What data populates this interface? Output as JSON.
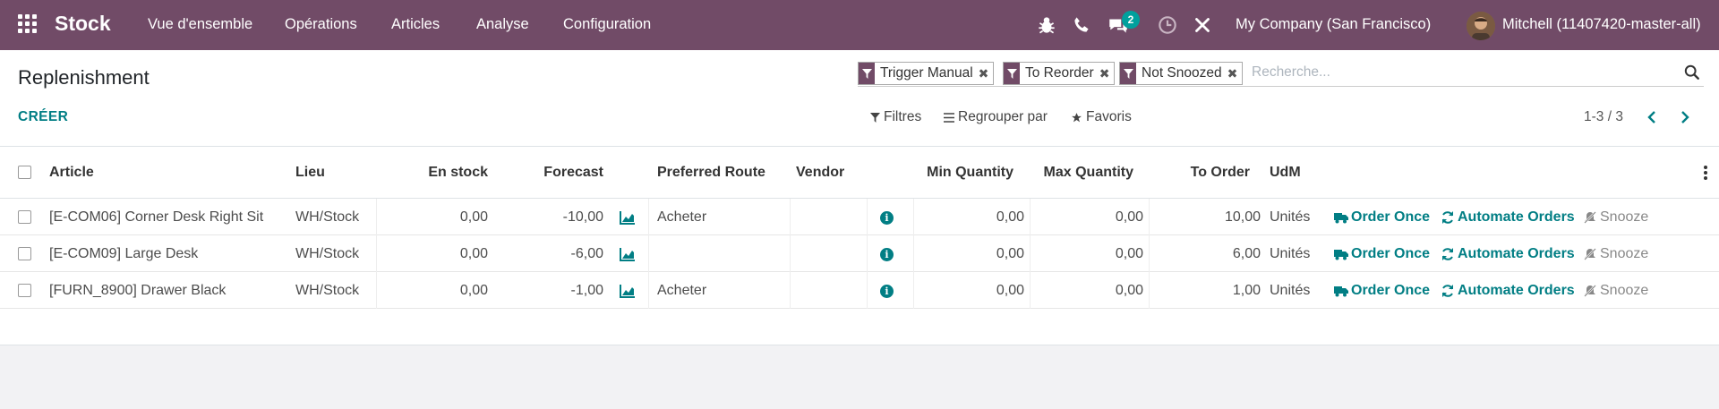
{
  "navbar": {
    "brand": "Stock",
    "menu": [
      "Vue d'ensemble",
      "Opérations",
      "Articles",
      "Analyse",
      "Configuration"
    ],
    "chat_badge": "2",
    "company": "My Company (San Francisco)",
    "user": "Mitchell (11407420-master-all)",
    "colors": {
      "bar": "#714b67",
      "badge": "#00a09d"
    }
  },
  "panel": {
    "title": "Replenishment",
    "create_label": "CRÉER",
    "facets": [
      "Trigger Manual",
      "To Reorder",
      "Not Snoozed"
    ],
    "search_placeholder": "Recherche...",
    "filters_label": "Filtres",
    "groupby_label": "Regrouper par",
    "favorites_label": "Favoris",
    "pager": "1-3 / 3"
  },
  "table": {
    "columns": [
      "Article",
      "Lieu",
      "En stock",
      "Forecast",
      "Preferred Route",
      "Vendor",
      "Min Quantity",
      "Max Quantity",
      "To Order",
      "UdM"
    ],
    "rows": [
      {
        "article": "[E-COM06] Corner Desk Right Sit",
        "lieu": "WH/Stock",
        "stock": "0,00",
        "forecast": "-10,00",
        "route": "Acheter",
        "vendor": "",
        "min": "0,00",
        "max": "0,00",
        "order": "10,00",
        "uom": "Unités"
      },
      {
        "article": "[E-COM09] Large Desk",
        "lieu": "WH/Stock",
        "stock": "0,00",
        "forecast": "-6,00",
        "route": "",
        "vendor": "",
        "min": "0,00",
        "max": "0,00",
        "order": "6,00",
        "uom": "Unités"
      },
      {
        "article": "[FURN_8900] Drawer Black",
        "lieu": "WH/Stock",
        "stock": "0,00",
        "forecast": "-1,00",
        "route": "Acheter",
        "vendor": "",
        "min": "0,00",
        "max": "0,00",
        "order": "1,00",
        "uom": "Unités"
      }
    ],
    "actions": {
      "order_once": "Order Once",
      "automate": "Automate Orders",
      "snooze": "Snooze"
    },
    "colors": {
      "action": "#017e84"
    }
  }
}
